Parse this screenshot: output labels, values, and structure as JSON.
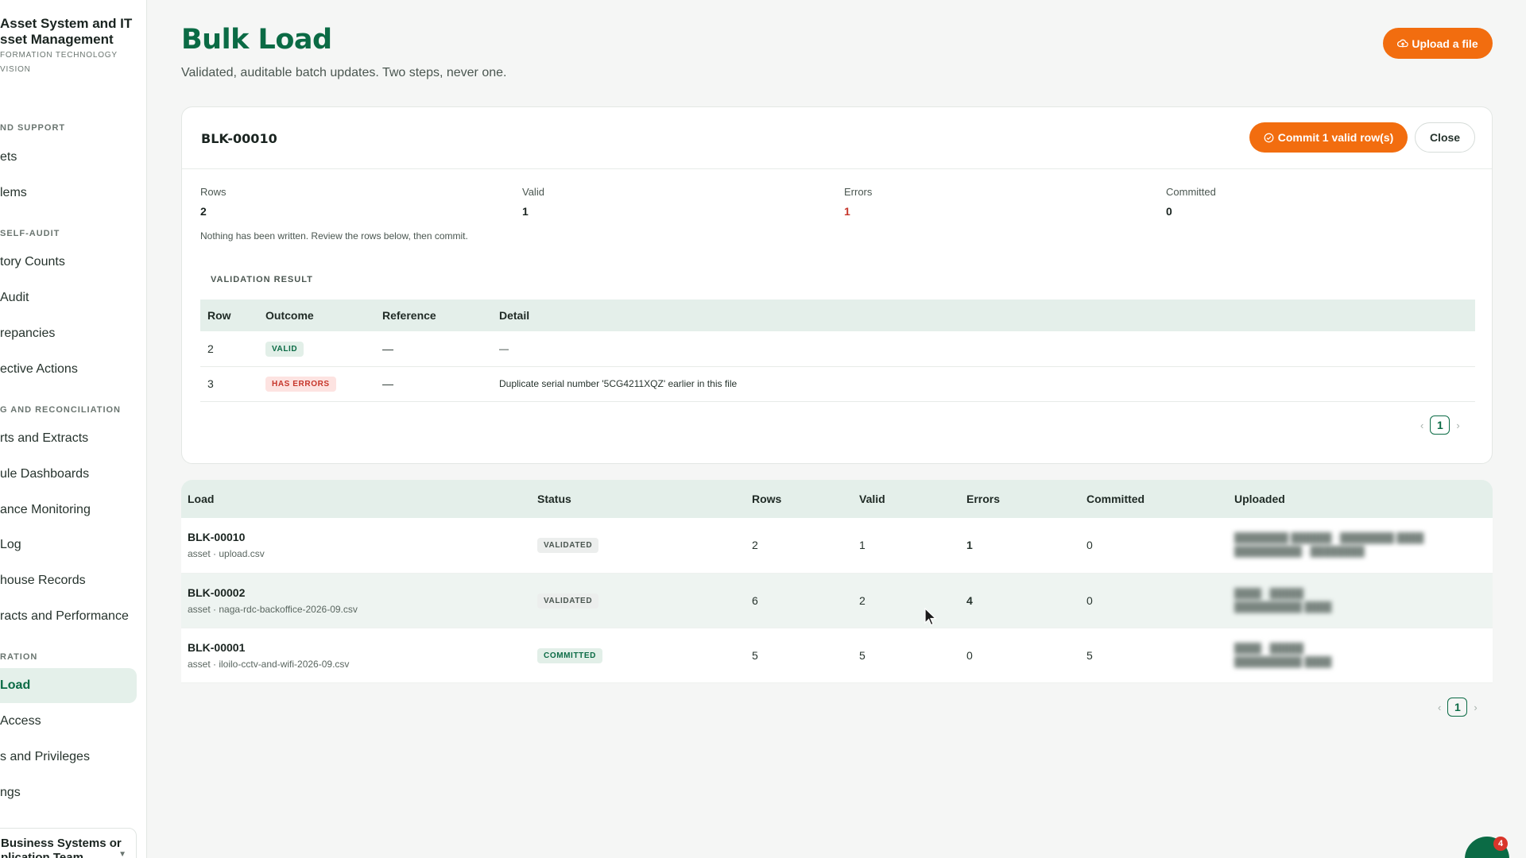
{
  "sidebar": {
    "brand_title_1": "Asset System and IT",
    "brand_title_2": "sset Management",
    "brand_sub_1": "FORMATION TECHNOLOGY",
    "brand_sub_2": "VISION",
    "sections": [
      "ND SUPPORT",
      "SELF-AUDIT",
      "G AND RECONCILIATION",
      "RATION"
    ],
    "items": [
      {
        "label": "ets"
      },
      {
        "label": "lems"
      },
      {
        "label": "tory Counts"
      },
      {
        "label": "Audit"
      },
      {
        "label": "repancies"
      },
      {
        "label": "ective Actions"
      },
      {
        "label": "rts and Extracts"
      },
      {
        "label": "ule Dashboards"
      },
      {
        "label": "ance Monitoring"
      },
      {
        "label": "Log"
      },
      {
        "label": "house Records"
      },
      {
        "label": "racts and Performance"
      },
      {
        "label": "Load"
      },
      {
        "label": "Access"
      },
      {
        "label": "s and Privileges"
      },
      {
        "label": "ngs"
      }
    ],
    "footer_line_1": "Business Systems or",
    "footer_line_2": "plication Team"
  },
  "header": {
    "title": "Bulk Load",
    "subtitle": "Validated, auditable batch updates. Two steps, never one.",
    "upload_label": "Upload a file"
  },
  "detail": {
    "id": "BLK-00010",
    "commit_label": "Commit 1 valid row(s)",
    "close_label": "Close",
    "stats": [
      {
        "label": "Rows",
        "value": "2"
      },
      {
        "label": "Valid",
        "value": "1"
      },
      {
        "label": "Errors",
        "value": "1"
      },
      {
        "label": "Committed",
        "value": "0"
      }
    ],
    "note": "Nothing has been written. Review the rows below, then commit.",
    "section_label": "VALIDATION RESULT",
    "columns": [
      "Row",
      "Outcome",
      "Reference",
      "Detail"
    ],
    "rows": [
      {
        "row": "2",
        "outcome": "VALID",
        "reference": "—",
        "detail": "—"
      },
      {
        "row": "3",
        "outcome": "HAS ERRORS",
        "reference": "—",
        "detail": "Duplicate serial number '5CG4211XQZ' earlier in this file"
      }
    ],
    "page": "1"
  },
  "loads": {
    "columns": [
      "Load",
      "Status",
      "Rows",
      "Valid",
      "Errors",
      "Committed",
      "Uploaded"
    ],
    "rows": [
      {
        "id": "BLK-00010",
        "file": "asset · upload.csv",
        "status": "VALIDATED",
        "rows": "2",
        "valid": "1",
        "errors": "1",
        "committed": "0"
      },
      {
        "id": "BLK-00002",
        "file": "asset · naga-rdc-backoffice-2026-09.csv",
        "status": "VALIDATED",
        "rows": "6",
        "valid": "2",
        "errors": "4",
        "committed": "0"
      },
      {
        "id": "BLK-00001",
        "file": "asset · iloilo-cctv-and-wifi-2026-09.csv",
        "status": "COMMITTED",
        "rows": "5",
        "valid": "5",
        "errors": "0",
        "committed": "5"
      }
    ],
    "page": "1"
  },
  "fab_badge": "4",
  "colors": {
    "brand": "#0b6b45",
    "accent": "#f26d0f",
    "error": "#c6352a"
  }
}
